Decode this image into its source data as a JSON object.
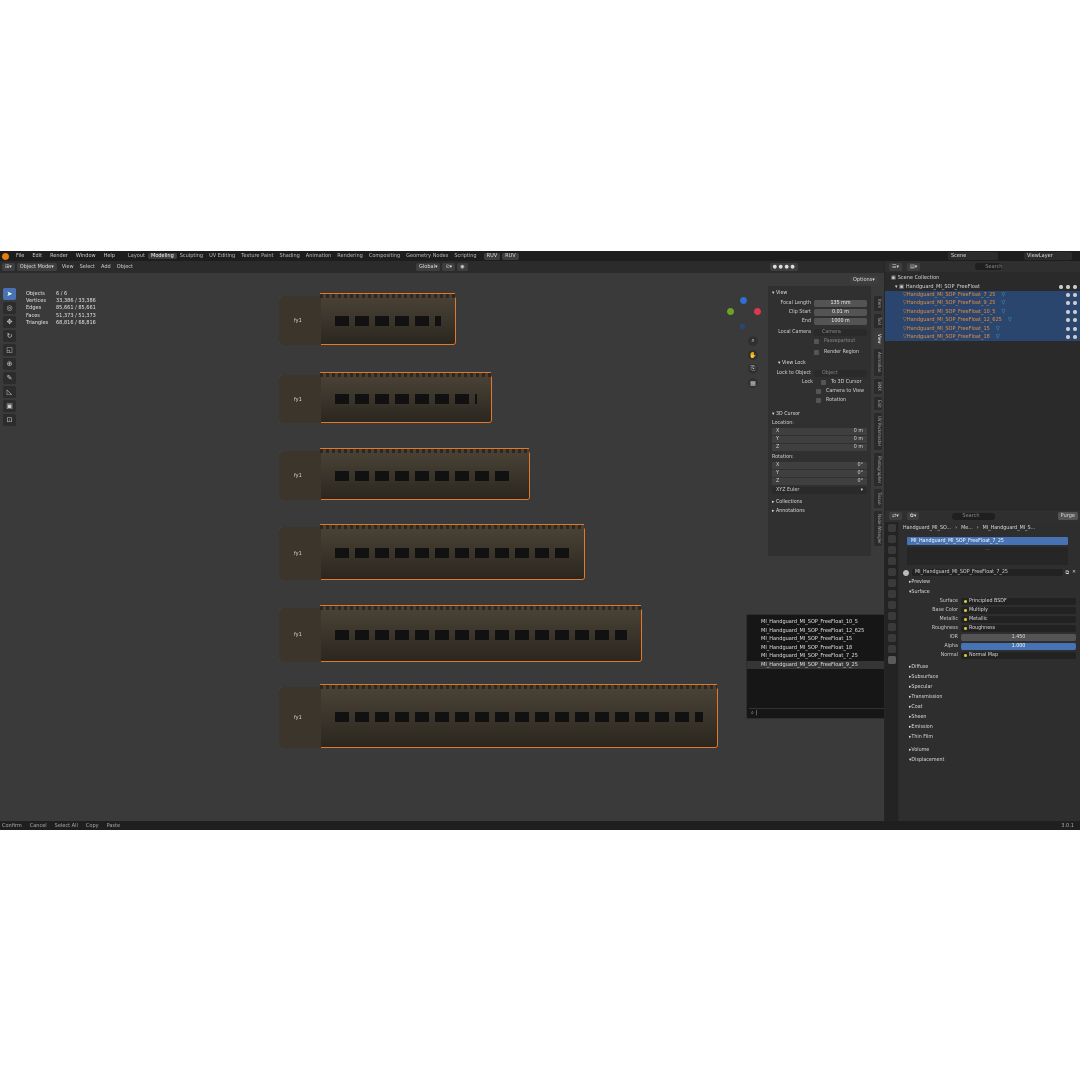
{
  "menubar": {
    "items": [
      "File",
      "Edit",
      "Render",
      "Window",
      "Help"
    ],
    "workspaces": [
      "Layout",
      "Modeling",
      "Sculpting",
      "UV Editing",
      "Texture Paint",
      "Shading",
      "Animation",
      "Rendering",
      "Compositing",
      "Geometry Nodes",
      "Scripting"
    ],
    "active_workspace": "Modeling",
    "uv_btn": "RUV",
    "uv_btn2": "RUV",
    "scene": "Scene",
    "view_layer": "ViewLayer"
  },
  "viewport": {
    "mode": "Object Mode",
    "menus": [
      "View",
      "Select",
      "Add",
      "Object"
    ],
    "orientation": "Global",
    "options": "Options",
    "stats": [
      {
        "k": "Objects",
        "v": "6 / 6"
      },
      {
        "k": "Vertices",
        "v": "33,386 / 33,386"
      },
      {
        "k": "Edges",
        "v": "85,661 / 85,661"
      },
      {
        "k": "Faces",
        "v": "51,373 / 51,373"
      },
      {
        "k": "Triangles",
        "v": "68,816 / 68,816"
      }
    ],
    "object_label": "fy1"
  },
  "npanel": {
    "view_header": "View",
    "focal_length_label": "Focal Length",
    "focal_length": "135 mm",
    "clip_start_label": "Clip Start",
    "clip_start": "0.01 m",
    "clip_end_label": "End",
    "clip_end": "1000 m",
    "local_camera_label": "Local Camera",
    "local_camera": "Camera",
    "passepartout": "Passepartout",
    "render_region": "Render Region",
    "view_lock_header": "View Lock",
    "lock_to_object_label": "Lock to Object",
    "lock_to_object": "Object",
    "lock_label": "Lock",
    "to_3d_cursor": "To 3D Cursor",
    "camera_to_view": "Camera to View",
    "rotation": "Rotation",
    "cursor_header": "3D Cursor",
    "location_label": "Location:",
    "rotation_label": "Rotation:",
    "loc": [
      {
        "a": "X",
        "v": "0 m"
      },
      {
        "a": "Y",
        "v": "0 m"
      },
      {
        "a": "Z",
        "v": "0 m"
      }
    ],
    "rot": [
      {
        "a": "X",
        "v": "0°"
      },
      {
        "a": "Y",
        "v": "0°"
      },
      {
        "a": "Z",
        "v": "0°"
      }
    ],
    "rotation_mode": "XYZ Euler",
    "collections": "Collections",
    "annotations": "Annotations",
    "tabs": [
      "Item",
      "Tool",
      "View",
      "Animation",
      "BMX",
      "Edit",
      "UV Packmaster",
      "Photographer",
      "Tissue",
      "Node Wrangler"
    ]
  },
  "dropdown": {
    "items": [
      "MI_Handguard_MI_SOP_FreeFloat_10_5",
      "MI_Handguard_MI_SOP_FreeFloat_12_625",
      "MI_Handguard_MI_SOP_FreeFloat_15",
      "MI_Handguard_MI_SOP_FreeFloat_18",
      "MI_Handguard_MI_SOP_FreeFloat_7_25",
      "MI_Handguard_MI_SOP_FreeFloat_9_25"
    ],
    "highlighted": 5
  },
  "statusbar": {
    "items": [
      "Confirm",
      "Cancel",
      "Select All",
      "Copy",
      "Paste"
    ],
    "version": "3.0.1"
  },
  "outliner": {
    "search_placeholder": "Search",
    "scene_collection": "Scene Collection",
    "collection": "Handguard_MI_SOP_FreeFloat",
    "objects": [
      "Handguard_MI_SOP_FreeFloat_7_25",
      "Handguard_MI_SOP_FreeFloat_9_25",
      "Handguard_MI_SOP_FreeFloat_10_5",
      "Handguard_MI_SOP_FreeFloat_12_625",
      "Handguard_MI_SOP_FreeFloat_15",
      "Handguard_MI_SOP_FreeFloat_18"
    ]
  },
  "properties": {
    "search_placeholder": "Search",
    "purge": "Purge",
    "breadcrumb": [
      "Handguard_MI_SO...",
      "Me...",
      "MI_Handguard_MI_S..."
    ],
    "material_slot": "MI_Handguard_MI_SOP_FreeFloat_7_25",
    "material_name": "MI_Handguard_MI_SOP_FreeFloat_7_25",
    "preview": "Preview",
    "surface_header": "Surface",
    "rows": [
      {
        "label": "Surface",
        "value": "Principled BSDF",
        "type": "link"
      },
      {
        "label": "Base Color",
        "value": "Multiply",
        "type": "link"
      },
      {
        "label": "Metallic",
        "value": "Metallic",
        "type": "link"
      },
      {
        "label": "Roughness",
        "value": "Roughness",
        "type": "link"
      },
      {
        "label": "IOR",
        "value": "1.450",
        "type": "num"
      },
      {
        "label": "Alpha",
        "value": "1.000",
        "type": "blue"
      },
      {
        "label": "Normal",
        "value": "Normal Map",
        "type": "link"
      }
    ],
    "subpanels": [
      "Diffuse",
      "Subsurface",
      "Specular",
      "Transmission",
      "Coat",
      "Sheen",
      "Emission",
      "Thin Film"
    ],
    "volume": "Volume",
    "displacement": "Displacement"
  }
}
